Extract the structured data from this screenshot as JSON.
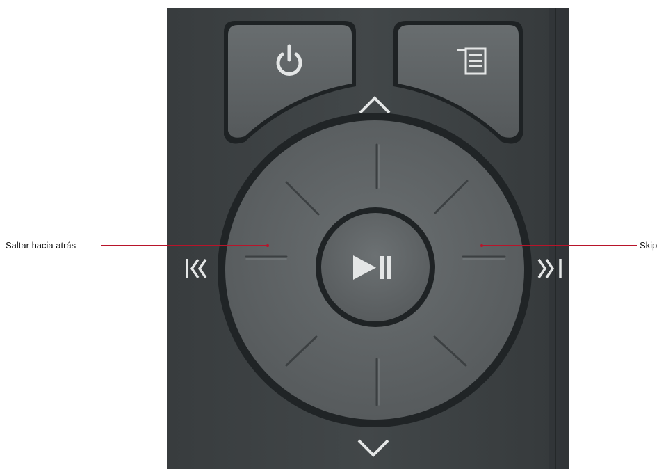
{
  "callouts": {
    "left": {
      "label": "Saltar hacia atrás"
    },
    "right": {
      "label": "Skip"
    }
  },
  "remote": {
    "buttons": [
      {
        "id": "power",
        "icon": "power-icon"
      },
      {
        "id": "menu",
        "icon": "menu-list-icon"
      },
      {
        "id": "up",
        "icon": "chevron-up-icon"
      },
      {
        "id": "down",
        "icon": "chevron-down-icon"
      },
      {
        "id": "skip-back",
        "icon": "skip-back-icon"
      },
      {
        "id": "skip-forward",
        "icon": "skip-forward-icon"
      },
      {
        "id": "play-pause",
        "icon": "play-pause-icon"
      }
    ]
  },
  "colors": {
    "body": "#3d4243",
    "button": "#5f6466",
    "ring": "#222628",
    "icon": "#e4e6e6",
    "leader_line": "#b8142a",
    "label_text": "#111111"
  }
}
